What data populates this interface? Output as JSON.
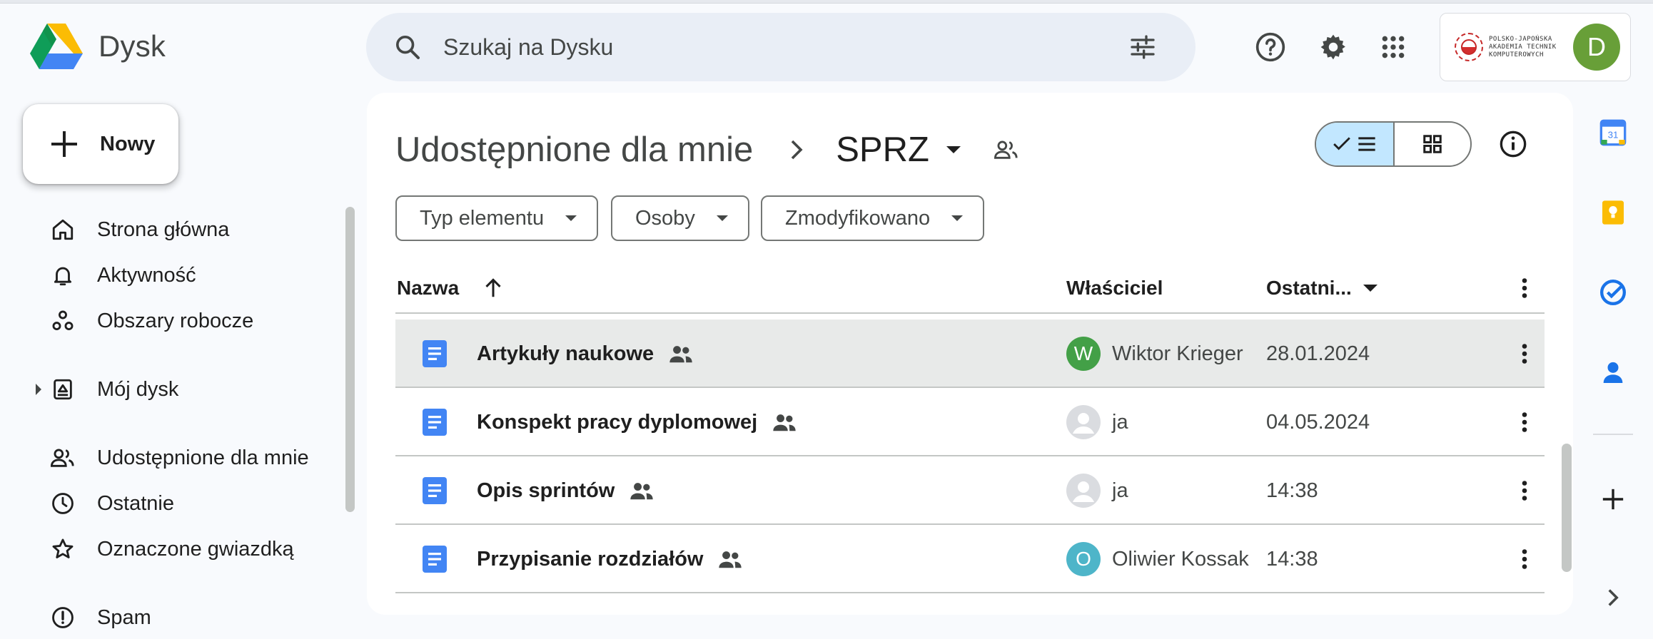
{
  "app": {
    "name": "Dysk"
  },
  "search": {
    "placeholder": "Szukaj na Dysku"
  },
  "header": {
    "avatar_letter": "D",
    "org_logo_lines": [
      "POLSKO-JAPOŃSKA",
      "AKADEMIA TECHNIK",
      "KOMPUTEROWYCH"
    ]
  },
  "sidebar": {
    "new_label": "Nowy",
    "items": [
      {
        "label": "Strona główna",
        "icon": "home-icon"
      },
      {
        "label": "Aktywność",
        "icon": "bell-icon"
      },
      {
        "label": "Obszary robocze",
        "icon": "workspaces-icon"
      },
      {
        "label": "Mój dysk",
        "icon": "my-drive-icon"
      },
      {
        "label": "Udostępnione dla mnie",
        "icon": "shared-people-icon"
      },
      {
        "label": "Ostatnie",
        "icon": "clock-icon"
      },
      {
        "label": "Oznaczone gwiazdką",
        "icon": "star-icon"
      },
      {
        "label": "Spam",
        "icon": "spam-icon"
      }
    ]
  },
  "breadcrumb": {
    "parent": "Udostępnione dla mnie",
    "current": "SPRZ"
  },
  "filters": [
    "Typ elementu",
    "Osoby",
    "Zmodyfikowano"
  ],
  "table": {
    "columns": {
      "name": "Nazwa",
      "owner": "Właściciel",
      "modified": "Ostatni..."
    },
    "rows": [
      {
        "name": "Artykuły naukowe",
        "owner": "Wiktor Krieger",
        "owner_initial": "W",
        "owner_color": "#43a047",
        "date": "28.01.2024",
        "selected": true
      },
      {
        "name": "Konspekt pracy dyplomowej",
        "owner": "ja",
        "owner_initial": "",
        "owner_color": "#dadce0",
        "date": "04.05.2024",
        "selected": false
      },
      {
        "name": "Opis sprintów",
        "owner": "ja",
        "owner_initial": "",
        "owner_color": "#dadce0",
        "date": "14:38",
        "selected": false
      },
      {
        "name": "Przypisanie rozdziałów",
        "owner": "Oliwier Kossak",
        "owner_initial": "O",
        "owner_color": "#4eb5c9",
        "date": "14:38",
        "selected": false
      }
    ]
  },
  "colors": {
    "accent": "#c2e7ff",
    "doc_blue": "#4285f4",
    "selected_row": "#e8eae9"
  },
  "right_rail": {
    "calendar_day": "31",
    "apps": [
      "calendar-icon",
      "keep-icon",
      "tasks-icon",
      "contacts-icon",
      "add-icon",
      "chevron-right-icon"
    ]
  }
}
